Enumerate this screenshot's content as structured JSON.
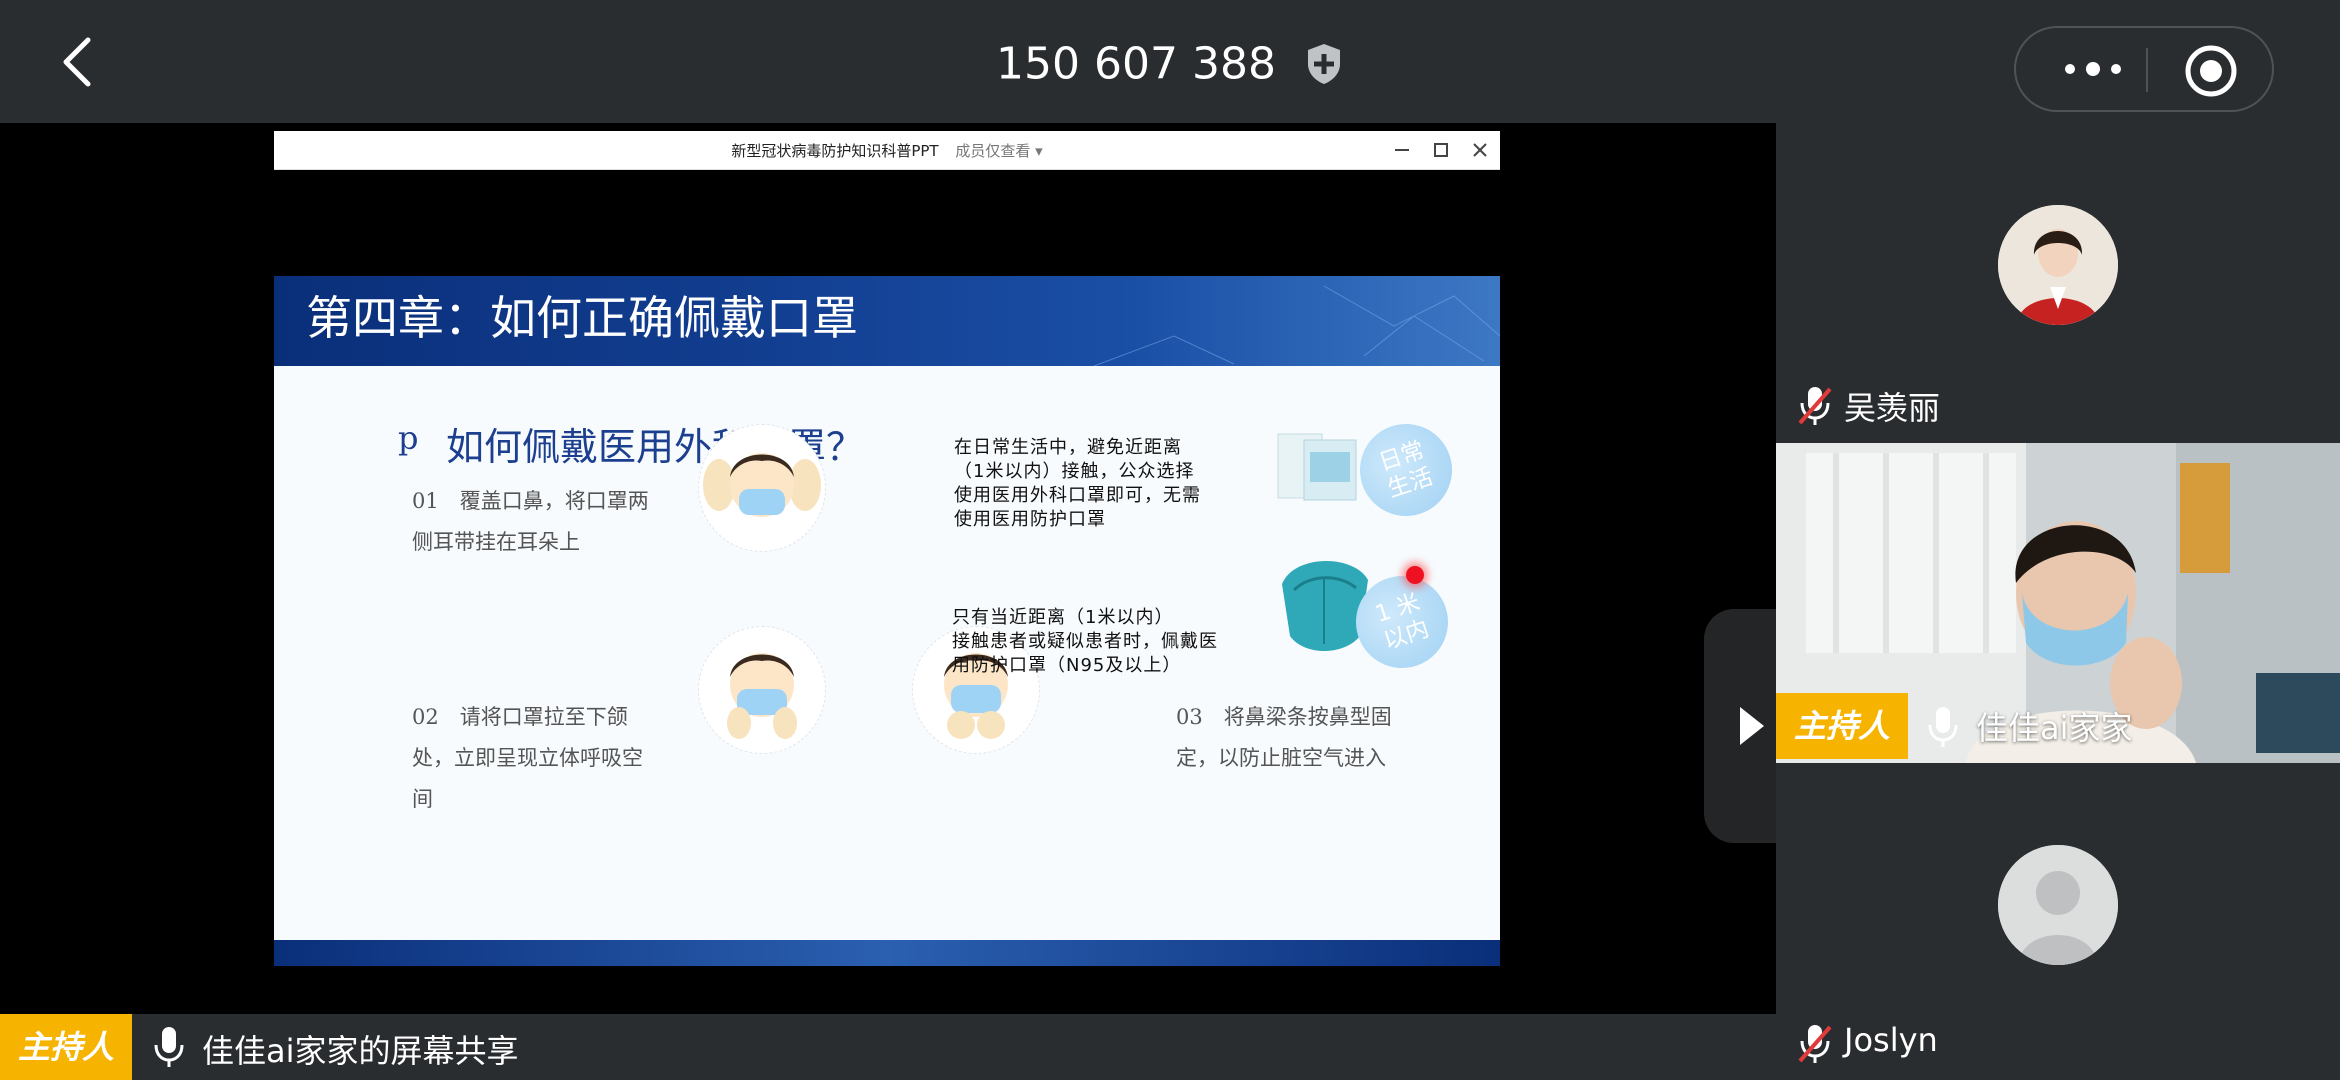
{
  "topbar": {
    "meeting_id": "150 607 388",
    "icons": {
      "back": "chevron-left-icon",
      "shield": "shield-plus-icon",
      "more": "more-dots-icon",
      "record": "record-icon"
    }
  },
  "ppt_window": {
    "title": "新型冠状病毒防护知识科普PPT",
    "view_mode": "成员仅查看 ▾"
  },
  "slide": {
    "heading": "第四章：如何正确佩戴口罩",
    "bullet": "p",
    "question": "如何佩戴医用外科口罩？",
    "step1_line1": "01　覆盖口鼻，将口罩两",
    "step1_line2": "侧耳带挂在耳朵上",
    "step2_line1": "02　请将口罩拉至下颌",
    "step2_line2": "处，立即呈现立体呼吸空",
    "step2_line3": "间",
    "step3_line1": "03　将鼻梁条按鼻型固",
    "step3_line2": "定，以防止脏空气进入",
    "tip1_line1": "在日常生活中，避免近距离",
    "tip1_line2": "（1米以内）接触，公众选择",
    "tip1_line3": "使用医用外科口罩即可，无需",
    "tip1_line4": "使用医用防护口罩",
    "tip2_line1": "只有当近距离（1米以内）",
    "tip2_line2": "接触患者或疑似患者时，佩戴医",
    "tip2_line3": "用防护口罩（N95及以上）",
    "badge1_line1": "日常",
    "badge1_line2": "生活",
    "badge2_line1": "1 米",
    "badge2_line2": "以内"
  },
  "share_bar": {
    "host_label": "主持人",
    "label": "佳佳ai家家的屏幕共享"
  },
  "participants": [
    {
      "name": "吴羡丽",
      "muted": true
    },
    {
      "name": "佳佳ai家家",
      "host_label": "主持人",
      "muted": false
    },
    {
      "name": "Joslyn",
      "muted": true
    }
  ],
  "colors": {
    "host_badge": "#f6b400",
    "bar_bg": "#2a2d30",
    "slide_blue": "#1d3f8f",
    "muted_red": "#e03a3a"
  }
}
